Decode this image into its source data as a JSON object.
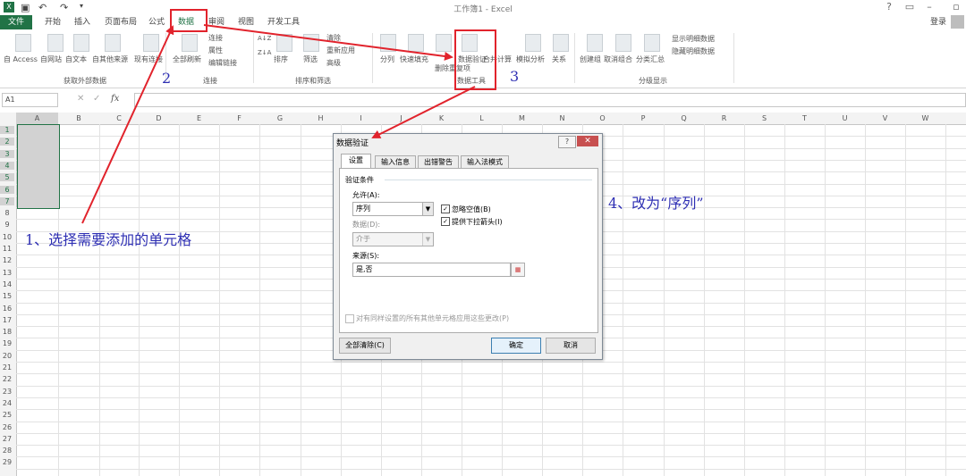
{
  "titlebar": {
    "title": "工作簿1 - Excel",
    "login": "登录"
  },
  "tabs": [
    "文件",
    "开始",
    "插入",
    "页面布局",
    "公式",
    "数据",
    "审阅",
    "视图",
    "开发工具"
  ],
  "ribbon": {
    "get_external": [
      "自 Access",
      "自网站",
      "自文本",
      "自其他来源",
      "现有连接"
    ],
    "refresh_all": "全部刷新",
    "connections_small": [
      "连接",
      "属性",
      "编辑链接"
    ],
    "sort_filter": [
      "排序",
      "筛选"
    ],
    "sort_small": [
      "清除",
      "重新应用",
      "高级"
    ],
    "data_tools": [
      "分列",
      "快速填充",
      "删除重复项",
      "数据验证",
      "合并计算",
      "模拟分析",
      "关系"
    ],
    "outline": [
      "创建组",
      "取消组合",
      "分类汇总"
    ],
    "outline_small": [
      "显示明细数据",
      "隐藏明细数据"
    ],
    "groups": [
      "获取外部数据",
      "连接",
      "排序和筛选",
      "数据工具",
      "分级显示"
    ]
  },
  "namebox": "A1",
  "fx": "fx",
  "columns": [
    "A",
    "B",
    "C",
    "D",
    "E",
    "F",
    "G",
    "H",
    "I",
    "J",
    "K",
    "L",
    "M",
    "N",
    "O",
    "P",
    "Q",
    "R",
    "S",
    "T",
    "U",
    "V",
    "W"
  ],
  "rows": [
    "1",
    "2",
    "3",
    "4",
    "5",
    "6",
    "7",
    "8",
    "9",
    "10",
    "11",
    "12",
    "13",
    "14",
    "15",
    "16",
    "17",
    "18",
    "19",
    "20",
    "21",
    "22",
    "23",
    "24",
    "25",
    "26",
    "27",
    "28",
    "29"
  ],
  "dialog": {
    "title": "数据验证",
    "help": "?",
    "close": "✕",
    "tabs": [
      "设置",
      "输入信息",
      "出错警告",
      "输入法模式"
    ],
    "section": "验证条件",
    "allow_label": "允许(A):",
    "allow_value": "序列",
    "ignore_blank": "忽略空值(B)",
    "dropdown": "提供下拉箭头(I)",
    "data_label": "数据(D):",
    "data_value": "介于",
    "source_label": "来源(S):",
    "source_value": "是,否",
    "apply_all": "对有同样设置的所有其他单元格应用这些更改(P)",
    "clear_all": "全部清除(C)",
    "ok": "确定",
    "cancel": "取消"
  },
  "annotations": {
    "step1": "1、选择需要添加的单元格",
    "step2": "2",
    "step3": "3",
    "step4": "4、改为“序列”"
  },
  "colors": {
    "excel_green": "#217346",
    "annotation_red": "#e1232c",
    "annotation_blue": "#2e2fb3"
  }
}
